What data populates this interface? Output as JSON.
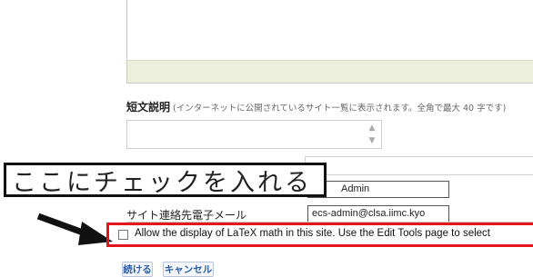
{
  "form": {
    "short_description": {
      "label": "短文説明",
      "hint": "(インターネットに公開されているサイト一覧に表示されます。全角で最大 40 字です)"
    },
    "admin_name": {
      "value": "Admin"
    },
    "admin_email": {
      "label": "サイト連絡先電子メール",
      "value": "ecs-admin@clsa.iimc.kyo"
    },
    "latex": {
      "label": "Allow the display of LaTeX math in this site. Use the Edit Tools page to select",
      "checked": false
    },
    "buttons": {
      "continue": "続ける",
      "cancel": "キャンセル"
    }
  },
  "annotation": {
    "callout": "ここにチェックを入れる",
    "highlight_color": "#e4161c"
  },
  "colors": {
    "textarea_footer": "#ecefd9",
    "button_text": "#2b5ea7"
  }
}
